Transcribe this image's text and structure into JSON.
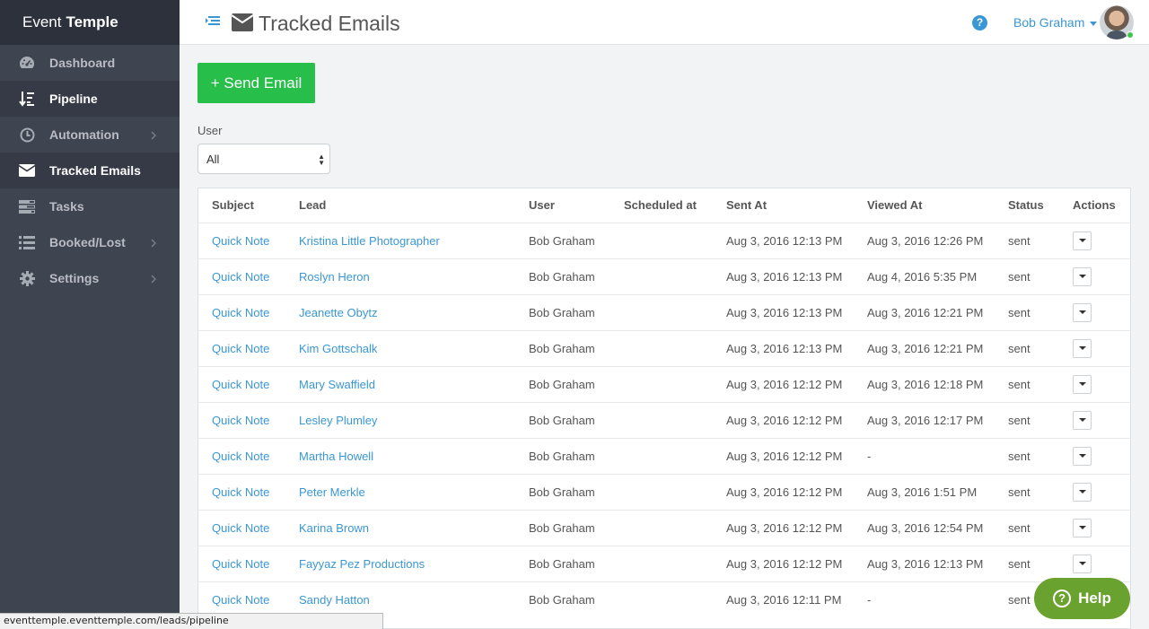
{
  "brand": {
    "part1": "Event",
    "part2": "Temple"
  },
  "sidebar": {
    "items": [
      {
        "label": "Dashboard",
        "icon": "dashboard-gauge-icon",
        "active": false,
        "has_submenu": false
      },
      {
        "label": "Pipeline",
        "icon": "pipeline-sort-icon",
        "active": true,
        "has_submenu": false
      },
      {
        "label": "Automation",
        "icon": "clock-icon",
        "active": false,
        "has_submenu": true
      },
      {
        "label": "Tracked Emails",
        "icon": "envelope-icon",
        "active": true,
        "has_submenu": false
      },
      {
        "label": "Tasks",
        "icon": "tasks-icon",
        "active": false,
        "has_submenu": false
      },
      {
        "label": "Booked/Lost",
        "icon": "list-icon",
        "active": false,
        "has_submenu": true
      },
      {
        "label": "Settings",
        "icon": "gear-icon",
        "active": false,
        "has_submenu": true
      }
    ]
  },
  "header": {
    "title": "Tracked Emails",
    "help_glyph": "?",
    "user_name": "Bob Graham"
  },
  "main": {
    "send_button": "+ Send Email",
    "filter_label": "User",
    "filter_value": "All"
  },
  "table": {
    "headers": [
      "Subject",
      "Lead",
      "User",
      "Scheduled at",
      "Sent At",
      "Viewed At",
      "Status",
      "Actions"
    ],
    "rows": [
      {
        "subject": "Quick Note",
        "lead": "Kristina Little Photographer",
        "user": "Bob Graham",
        "scheduled": "",
        "sent": "Aug 3, 2016 12:13 PM",
        "viewed": "Aug 3, 2016 12:26 PM",
        "status": "sent"
      },
      {
        "subject": "Quick Note",
        "lead": "Roslyn Heron",
        "user": "Bob Graham",
        "scheduled": "",
        "sent": "Aug 3, 2016 12:13 PM",
        "viewed": "Aug 4, 2016 5:35 PM",
        "status": "sent"
      },
      {
        "subject": "Quick Note",
        "lead": "Jeanette Obytz",
        "user": "Bob Graham",
        "scheduled": "",
        "sent": "Aug 3, 2016 12:13 PM",
        "viewed": "Aug 3, 2016 12:21 PM",
        "status": "sent"
      },
      {
        "subject": "Quick Note",
        "lead": "Kim Gottschalk",
        "user": "Bob Graham",
        "scheduled": "",
        "sent": "Aug 3, 2016 12:13 PM",
        "viewed": "Aug 3, 2016 12:21 PM",
        "status": "sent"
      },
      {
        "subject": "Quick Note",
        "lead": "Mary Swaffield",
        "user": "Bob Graham",
        "scheduled": "",
        "sent": "Aug 3, 2016 12:12 PM",
        "viewed": "Aug 3, 2016 12:18 PM",
        "status": "sent"
      },
      {
        "subject": "Quick Note",
        "lead": "Lesley Plumley",
        "user": "Bob Graham",
        "scheduled": "",
        "sent": "Aug 3, 2016 12:12 PM",
        "viewed": "Aug 3, 2016 12:17 PM",
        "status": "sent"
      },
      {
        "subject": "Quick Note",
        "lead": "Martha Howell",
        "user": "Bob Graham",
        "scheduled": "",
        "sent": "Aug 3, 2016 12:12 PM",
        "viewed": "-",
        "status": "sent"
      },
      {
        "subject": "Quick Note",
        "lead": "Peter Merkle",
        "user": "Bob Graham",
        "scheduled": "",
        "sent": "Aug 3, 2016 12:12 PM",
        "viewed": "Aug 3, 2016 1:51 PM",
        "status": "sent"
      },
      {
        "subject": "Quick Note",
        "lead": "Karina Brown",
        "user": "Bob Graham",
        "scheduled": "",
        "sent": "Aug 3, 2016 12:12 PM",
        "viewed": "Aug 3, 2016 12:54 PM",
        "status": "sent"
      },
      {
        "subject": "Quick Note",
        "lead": "Fayyaz Pez Productions",
        "user": "Bob Graham",
        "scheduled": "",
        "sent": "Aug 3, 2016 12:12 PM",
        "viewed": "Aug 3, 2016 12:13 PM",
        "status": "sent"
      },
      {
        "subject": "Quick Note",
        "lead": "Sandy Hatton",
        "user": "Bob Graham",
        "scheduled": "",
        "sent": "Aug 3, 2016 12:11 PM",
        "viewed": "-",
        "status": "sent"
      }
    ]
  },
  "help_widget": {
    "label": "Help"
  },
  "status_url": "eventtemple.eventtemple.com/leads/pipeline",
  "colors": {
    "sidebar": "#3f4451",
    "brand_bar": "#2d313b",
    "accent": "#3a97d4",
    "send_button": "#27bf4a",
    "help_widget": "#6aa22f"
  }
}
